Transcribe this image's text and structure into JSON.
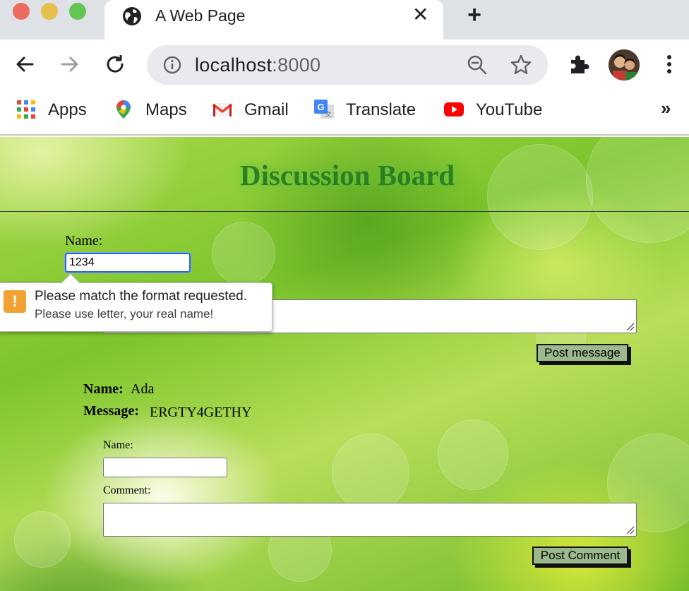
{
  "browser": {
    "tab_title": "A Web Page",
    "url_host": "localhost",
    "url_port": ":8000",
    "bookmarks": [
      {
        "label": "Apps",
        "icon": "apps-grid-icon"
      },
      {
        "label": "Maps",
        "icon": "maps-pin-icon"
      },
      {
        "label": "Gmail",
        "icon": "gmail-icon"
      },
      {
        "label": "Translate",
        "icon": "translate-icon"
      },
      {
        "label": "YouTube",
        "icon": "youtube-icon"
      }
    ],
    "more_bookmarks": "»"
  },
  "page": {
    "title": "Discussion Board",
    "post_form": {
      "name_label": "Name:",
      "name_value": "1234",
      "post_button": "Post message"
    },
    "validation": {
      "title": "Please match the format requested.",
      "detail": "Please use letter, your real name!"
    },
    "messages": [
      {
        "name_label": "Name:",
        "name": "Ada",
        "message_label": "Message:",
        "message": "ERGTY4GETHY",
        "comment_form": {
          "name_label": "Name:",
          "comment_label": "Comment:",
          "post_button": "Post Comment"
        }
      }
    ]
  },
  "colors": {
    "title_green": "#2f7e22",
    "button_bg": "#9bb98d",
    "focus_blue": "#2b66d9",
    "warning_orange": "#f2a233"
  }
}
